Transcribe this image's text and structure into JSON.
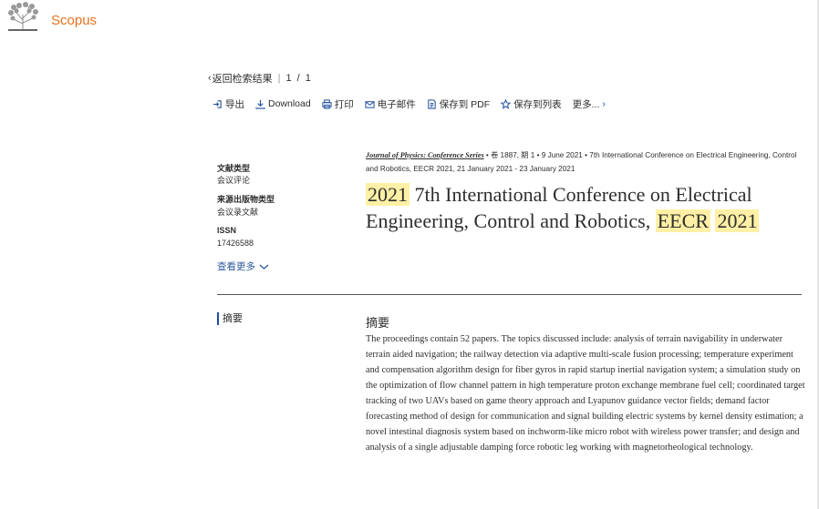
{
  "header": {
    "brand": "Scopus"
  },
  "breadcrumb": {
    "back": "返回检索结果",
    "page": "1",
    "sep": "/",
    "total": "1"
  },
  "toolbar": {
    "export": "导出",
    "download": "Download",
    "print": "打印",
    "email": "电子邮件",
    "save_pdf": "保存到 PDF",
    "save_list": "保存到列表",
    "more": "更多..."
  },
  "meta": {
    "doc_type_label": "文献类型",
    "doc_type_value": "会议评论",
    "source_type_label": "来源出版物类型",
    "source_type_value": "会议录文献",
    "issn_label": "ISSN",
    "issn_value": "17426588",
    "view_more": "查看更多"
  },
  "source": {
    "journal": "Journal of Physics: Conference Series",
    "volume": "卷 1887, 期 1",
    "date": "9 June 2021",
    "conference": "7th International Conference on Electrical Engineering, Control and Robotics, EECR 2021, 21 January 2021 - 23 January 2021"
  },
  "title": {
    "year": "2021",
    "mid": "7th International Conference on Electrical Engineering, Control and Robotics,",
    "acronym": "EECR",
    "year2": "2021"
  },
  "abstract": {
    "tab": "摘要",
    "heading": "摘要",
    "text": "The proceedings contain 52 papers. The topics discussed include: analysis of terrain navigability in underwater terrain aided navigation; the railway detection via adaptive multi-scale fusion processing; temperature experiment and compensation algorithm design for fiber gyros in rapid startup inertial navigation system; a simulation study on the optimization of flow channel pattern in high temperature proton exchange membrane fuel cell; coordinated target tracking of two UAVs based on game theory approach and Lyapunov guidance vector fields; demand factor forecasting method of design for communication and signal building electric systems by kernel density estimation; a novel intestinal diagnosis system based on inchworm-like micro robot with wireless power transfer; and design and analysis of a single adjustable damping force robotic leg working with magnetorheological technology."
  },
  "colors": {
    "brand": "#e9711c",
    "highlight": "#fff0a5",
    "link": "#2e5a9c",
    "accent_bar": "#1f4e9c"
  }
}
